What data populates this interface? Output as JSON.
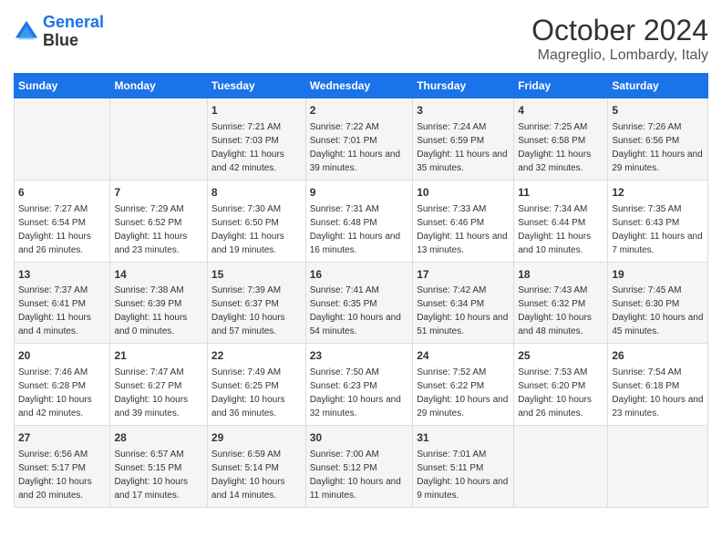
{
  "logo": {
    "line1": "General",
    "line2": "Blue"
  },
  "title": "October 2024",
  "subtitle": "Magreglio, Lombardy, Italy",
  "days_of_week": [
    "Sunday",
    "Monday",
    "Tuesday",
    "Wednesday",
    "Thursday",
    "Friday",
    "Saturday"
  ],
  "weeks": [
    [
      {
        "day": "",
        "info": ""
      },
      {
        "day": "",
        "info": ""
      },
      {
        "day": "1",
        "info": "Sunrise: 7:21 AM\nSunset: 7:03 PM\nDaylight: 11 hours and 42 minutes."
      },
      {
        "day": "2",
        "info": "Sunrise: 7:22 AM\nSunset: 7:01 PM\nDaylight: 11 hours and 39 minutes."
      },
      {
        "day": "3",
        "info": "Sunrise: 7:24 AM\nSunset: 6:59 PM\nDaylight: 11 hours and 35 minutes."
      },
      {
        "day": "4",
        "info": "Sunrise: 7:25 AM\nSunset: 6:58 PM\nDaylight: 11 hours and 32 minutes."
      },
      {
        "day": "5",
        "info": "Sunrise: 7:26 AM\nSunset: 6:56 PM\nDaylight: 11 hours and 29 minutes."
      }
    ],
    [
      {
        "day": "6",
        "info": "Sunrise: 7:27 AM\nSunset: 6:54 PM\nDaylight: 11 hours and 26 minutes."
      },
      {
        "day": "7",
        "info": "Sunrise: 7:29 AM\nSunset: 6:52 PM\nDaylight: 11 hours and 23 minutes."
      },
      {
        "day": "8",
        "info": "Sunrise: 7:30 AM\nSunset: 6:50 PM\nDaylight: 11 hours and 19 minutes."
      },
      {
        "day": "9",
        "info": "Sunrise: 7:31 AM\nSunset: 6:48 PM\nDaylight: 11 hours and 16 minutes."
      },
      {
        "day": "10",
        "info": "Sunrise: 7:33 AM\nSunset: 6:46 PM\nDaylight: 11 hours and 13 minutes."
      },
      {
        "day": "11",
        "info": "Sunrise: 7:34 AM\nSunset: 6:44 PM\nDaylight: 11 hours and 10 minutes."
      },
      {
        "day": "12",
        "info": "Sunrise: 7:35 AM\nSunset: 6:43 PM\nDaylight: 11 hours and 7 minutes."
      }
    ],
    [
      {
        "day": "13",
        "info": "Sunrise: 7:37 AM\nSunset: 6:41 PM\nDaylight: 11 hours and 4 minutes."
      },
      {
        "day": "14",
        "info": "Sunrise: 7:38 AM\nSunset: 6:39 PM\nDaylight: 11 hours and 0 minutes."
      },
      {
        "day": "15",
        "info": "Sunrise: 7:39 AM\nSunset: 6:37 PM\nDaylight: 10 hours and 57 minutes."
      },
      {
        "day": "16",
        "info": "Sunrise: 7:41 AM\nSunset: 6:35 PM\nDaylight: 10 hours and 54 minutes."
      },
      {
        "day": "17",
        "info": "Sunrise: 7:42 AM\nSunset: 6:34 PM\nDaylight: 10 hours and 51 minutes."
      },
      {
        "day": "18",
        "info": "Sunrise: 7:43 AM\nSunset: 6:32 PM\nDaylight: 10 hours and 48 minutes."
      },
      {
        "day": "19",
        "info": "Sunrise: 7:45 AM\nSunset: 6:30 PM\nDaylight: 10 hours and 45 minutes."
      }
    ],
    [
      {
        "day": "20",
        "info": "Sunrise: 7:46 AM\nSunset: 6:28 PM\nDaylight: 10 hours and 42 minutes."
      },
      {
        "day": "21",
        "info": "Sunrise: 7:47 AM\nSunset: 6:27 PM\nDaylight: 10 hours and 39 minutes."
      },
      {
        "day": "22",
        "info": "Sunrise: 7:49 AM\nSunset: 6:25 PM\nDaylight: 10 hours and 36 minutes."
      },
      {
        "day": "23",
        "info": "Sunrise: 7:50 AM\nSunset: 6:23 PM\nDaylight: 10 hours and 32 minutes."
      },
      {
        "day": "24",
        "info": "Sunrise: 7:52 AM\nSunset: 6:22 PM\nDaylight: 10 hours and 29 minutes."
      },
      {
        "day": "25",
        "info": "Sunrise: 7:53 AM\nSunset: 6:20 PM\nDaylight: 10 hours and 26 minutes."
      },
      {
        "day": "26",
        "info": "Sunrise: 7:54 AM\nSunset: 6:18 PM\nDaylight: 10 hours and 23 minutes."
      }
    ],
    [
      {
        "day": "27",
        "info": "Sunrise: 6:56 AM\nSunset: 5:17 PM\nDaylight: 10 hours and 20 minutes."
      },
      {
        "day": "28",
        "info": "Sunrise: 6:57 AM\nSunset: 5:15 PM\nDaylight: 10 hours and 17 minutes."
      },
      {
        "day": "29",
        "info": "Sunrise: 6:59 AM\nSunset: 5:14 PM\nDaylight: 10 hours and 14 minutes."
      },
      {
        "day": "30",
        "info": "Sunrise: 7:00 AM\nSunset: 5:12 PM\nDaylight: 10 hours and 11 minutes."
      },
      {
        "day": "31",
        "info": "Sunrise: 7:01 AM\nSunset: 5:11 PM\nDaylight: 10 hours and 9 minutes."
      },
      {
        "day": "",
        "info": ""
      },
      {
        "day": "",
        "info": ""
      }
    ]
  ]
}
